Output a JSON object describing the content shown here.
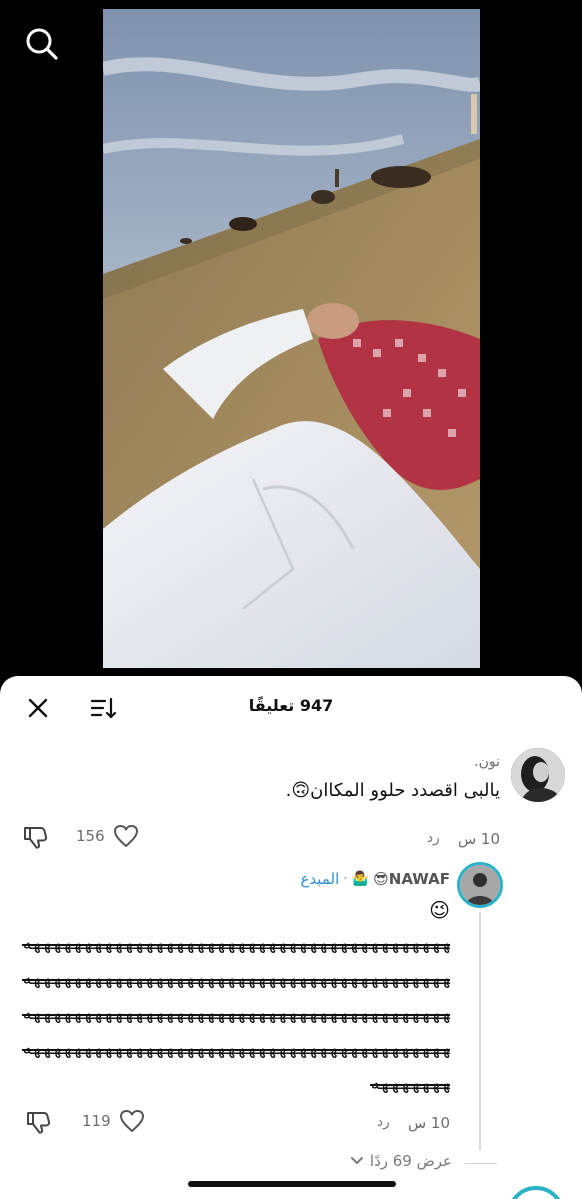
{
  "video": {
    "search_icon": "search-icon",
    "description": ""
  },
  "sheet": {
    "title": "947 تعليقًا",
    "close_icon": "close-icon",
    "sort_icon": "sort-icon"
  },
  "comments": [
    {
      "author": "نون.",
      "text": "يالبى اقصدد حلوو المكاان🙃.",
      "time": "10 س",
      "reply_label": "رد",
      "likes": "156"
    },
    {
      "author_name": "NAWAF😎",
      "author_badge": "🤷‍♂️",
      "author_separator": "·",
      "author_tag": "المبدع",
      "text_line1": "😉",
      "crossed_lines": [
        "ههههههههههههههههههههههههههههههههههههههههههههههه",
        "هههههههههههههههههههههههههههههههههههههههههههههههه",
        "هههههههههههههههههههههههههههههههههههههههههههههههه",
        "هههههههههههههههههههههههههههههههههههههههههههههههه",
        "هههههههههه"
      ],
      "time": "10 س",
      "reply_label": "رد",
      "likes": "119"
    }
  ],
  "view_replies": "عرض 69 ردًا",
  "colors": {
    "accent_ring": "#2ab3c8",
    "tag_blue": "#2b8fd6"
  }
}
